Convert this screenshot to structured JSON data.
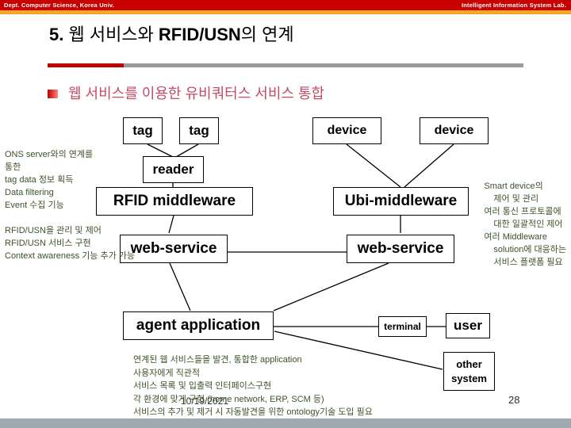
{
  "header": {
    "left": "Dept. Computer Science, Korea Univ.",
    "right": "Intelligent Information System Lab."
  },
  "slide": {
    "title_number": "5.",
    "title_part1": " 웹 서비스와 ",
    "title_emphasis": "RFID/USN",
    "title_part2": "의 연계",
    "subtitle": "웹 서비스를 이용한 유비쿼터스 서비스 통합",
    "date": "10/19/2021",
    "page_number": "28"
  },
  "colors": {
    "header_red": "#c80000",
    "header_orange": "#f5a623",
    "bar_red": "#c00000",
    "bar_gray": "#9a9a9a",
    "subtitle_text": "#c34a67",
    "note_text": "#3d5229",
    "footer_bar": "#9fa9b0"
  },
  "diagram": {
    "boxes": [
      {
        "id": "tag1",
        "label": "tag"
      },
      {
        "id": "tag2",
        "label": "tag"
      },
      {
        "id": "reader",
        "label": "reader"
      },
      {
        "id": "device1",
        "label": "device"
      },
      {
        "id": "device2",
        "label": "device"
      },
      {
        "id": "rfid_middleware",
        "label": "RFID middleware"
      },
      {
        "id": "ubi_middleware",
        "label": "Ubi-middleware"
      },
      {
        "id": "web_service_left",
        "label": "web-service"
      },
      {
        "id": "web_service_right",
        "label": "web-service"
      },
      {
        "id": "agent_application",
        "label": "agent application"
      },
      {
        "id": "terminal",
        "label": "terminal"
      },
      {
        "id": "user",
        "label": "user"
      },
      {
        "id": "other_system_line1",
        "label": "other"
      },
      {
        "id": "other_system_line2",
        "label": "system"
      }
    ]
  },
  "notes": {
    "left_top": [
      "ONS server와의 연계를",
      "통한",
      "tag data 정보 획득",
      "Data filtering",
      "Event 수집 기능"
    ],
    "left_bottom": [
      "RFID/USN을 관리 및 제어",
      "RFID/USN 서비스 구현",
      "Context awareness 기능 추가 가능"
    ],
    "right": [
      "Smart device의",
      "제어 및 관리",
      "여러 통신 프로토콜에",
      "대한 일괄적인 제어",
      "여러 Middleware",
      "solution에 대응하는",
      "서비스 플랫폼 필요"
    ],
    "bottom": [
      "연계된 웹 서비스들을 발견, 통합한 application",
      "사용자에게 직관적",
      "서비스 목록 및 입출력 인터페이스구현",
      "각 환경에 맞게 구현 (home network, ERP, SCM 등)",
      "서비스의 추가 및 제거 시 자동발견을 위한 ontology기술 도입 필요"
    ]
  }
}
